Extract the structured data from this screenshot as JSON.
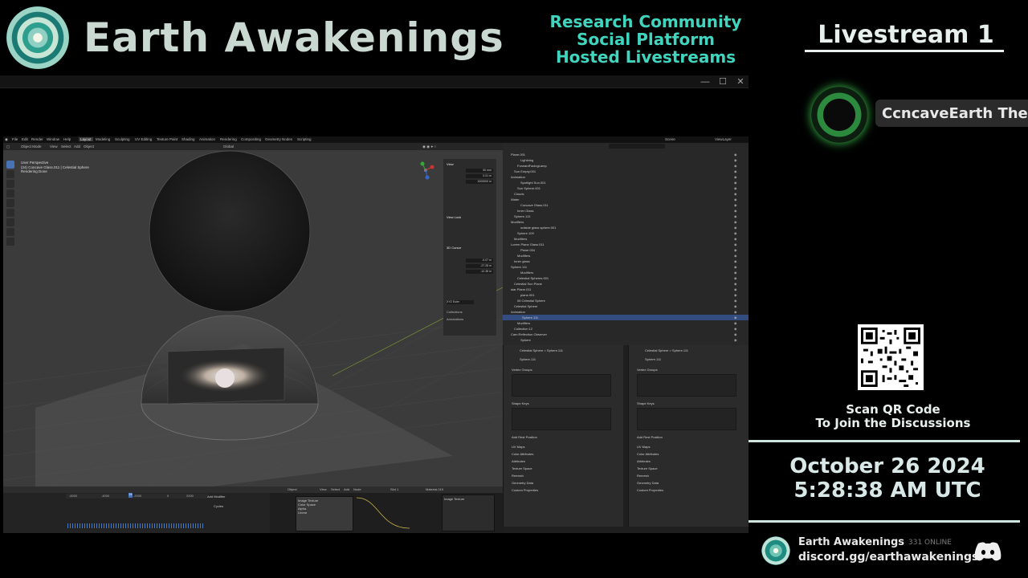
{
  "header": {
    "brand": "Earth Awakenings",
    "tagline": [
      "Research Community",
      "Social Platform",
      "Hosted Livestreams"
    ],
    "stream_title": "Livestream 1"
  },
  "channel": {
    "name": "CcncaveEarth Theo"
  },
  "qr": {
    "caption_line1": "Scan QR Code",
    "caption_line2": "To Join the Discussions"
  },
  "datetime": {
    "date": "October 26 2024",
    "time": "5:28:38 AM UTC"
  },
  "discord": {
    "server": "Earth Awakenings",
    "online": "331 ONLINE",
    "link": "discord.gg/earthawakenings"
  },
  "window": {
    "minimize": "—",
    "maximize": "☐",
    "close": "✕"
  },
  "blender": {
    "menu": [
      "File",
      "Edit",
      "Render",
      "Window",
      "Help"
    ],
    "workspaces": [
      "Layout",
      "Modeling",
      "Sculpting",
      "UV Editing",
      "Texture Paint",
      "Shading",
      "Animation",
      "Rendering",
      "Compositing",
      "Geometry Nodes",
      "Scripting"
    ],
    "scene": "Scene",
    "view_layer": "ViewLayer",
    "viewport": {
      "mode": "Object Mode",
      "menus": [
        "View",
        "Select",
        "Add",
        "Object"
      ],
      "transform": "Global",
      "overlay_text": [
        "User Perspective",
        "(24) Concave Glass.011 | Celestial Sphere",
        "Rendering Done"
      ]
    },
    "npanel": {
      "section": "View",
      "focal": "50 mm",
      "clip_start": "0.01 m",
      "clip_end": "1000000 m",
      "view_lock": "View Lock",
      "cursor": "3D Cursor",
      "loc_x": "-0.07 m",
      "loc_y": "-27.28 m",
      "loc_z": "-12.38 m",
      "rotation": "XYZ Euler",
      "collections": "Collections",
      "annotations": "Annotations"
    },
    "outliner": {
      "rows": [
        "Plane.001",
        "Lightning",
        "ForwardFacingLamp",
        "Sun Empty.001",
        "Animation",
        "Spotlight Sun.001",
        "Sun Sphere.001",
        "Clouds",
        "Water",
        "Concave Glass.011",
        "Inner Glass",
        "Sphere.113",
        "Modifiers",
        "outside glass sphere.001",
        "Sphere.109",
        "Modifiers",
        "Lorem Plane Glass.011",
        "Plane.004",
        "Modifiers",
        "Inner glass",
        "Sphere.111",
        "Modifiers",
        "Celestial Spheres.001",
        "Celestial Sun Plane",
        "star Plane.011",
        "plane.001",
        "06 Celestial Sphere",
        "Celestial Sphere",
        "Animation",
        "Sphere.111",
        "Modifiers",
        "Collection 12",
        "Cam.Reflection Observer",
        "Sphere"
      ],
      "selected_index": 29
    },
    "props_left": {
      "crumb": "Celestial Sphere > Sphere.111",
      "mesh": "Sphere.111",
      "sections": [
        "Vertex Groups",
        "Shape Keys",
        "Add Rest Position",
        "UV Maps",
        "Color Attributes",
        "Attributes",
        "Texture Space",
        "Remesh",
        "Geometry Data",
        "Custom Properties"
      ]
    },
    "props_right": {
      "crumb": "Celestial Sphere > Sphere.111",
      "mesh": "Sphere.111",
      "sections": [
        "Vertex Groups",
        "Shape Keys",
        "Add Rest Position",
        "UV Maps",
        "Color Attributes",
        "Attributes",
        "Texture Space",
        "Remesh",
        "Geometry Data",
        "Custom Properties"
      ]
    },
    "timeline": {
      "ticks": [
        "-6000",
        "-4000",
        "-2000",
        "0",
        "2000"
      ],
      "frame": "24",
      "modifier": "Add Modifier",
      "cycles": "Cycles"
    },
    "node_editor": {
      "object": "Object",
      "material": "Material.019",
      "menus": [
        "View",
        "Select",
        "Add",
        "Node"
      ],
      "slot": "Slot 1",
      "node": "Image Texture",
      "props": [
        "Image Texture",
        "Color Space",
        "Alpha",
        "Linear"
      ]
    }
  },
  "colors": {
    "accent_teal": "#3fd5bf",
    "brand_text": "#c9d9d2",
    "selection_blue": "#334d80",
    "discord_green": "#3cc44e"
  }
}
